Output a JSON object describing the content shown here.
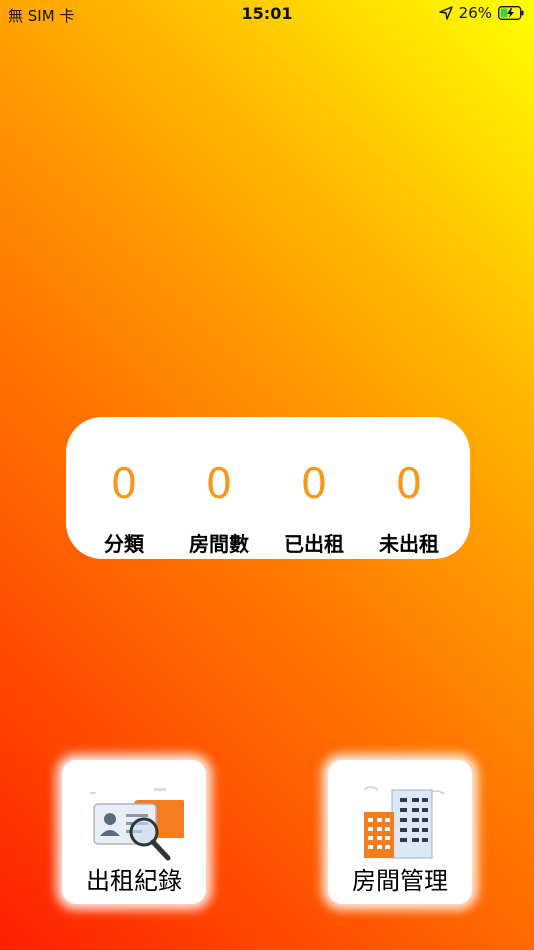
{
  "status_bar": {
    "carrier": "無 SIM 卡",
    "time": "15:01",
    "battery_percent": "26%"
  },
  "stats": [
    {
      "value": "0",
      "label": "分類"
    },
    {
      "value": "0",
      "label": "房間數"
    },
    {
      "value": "0",
      "label": "已出租"
    },
    {
      "value": "0",
      "label": "未出租"
    }
  ],
  "tiles": {
    "rental_records": {
      "label": "出租紀錄",
      "icon": "id-card-search-icon"
    },
    "room_management": {
      "label": "房間管理",
      "icon": "building-icon"
    }
  },
  "colors": {
    "gradient_top_right": "#ffff00",
    "gradient_bottom_left": "#ff1e00",
    "stat_value": "#f39a1d"
  }
}
